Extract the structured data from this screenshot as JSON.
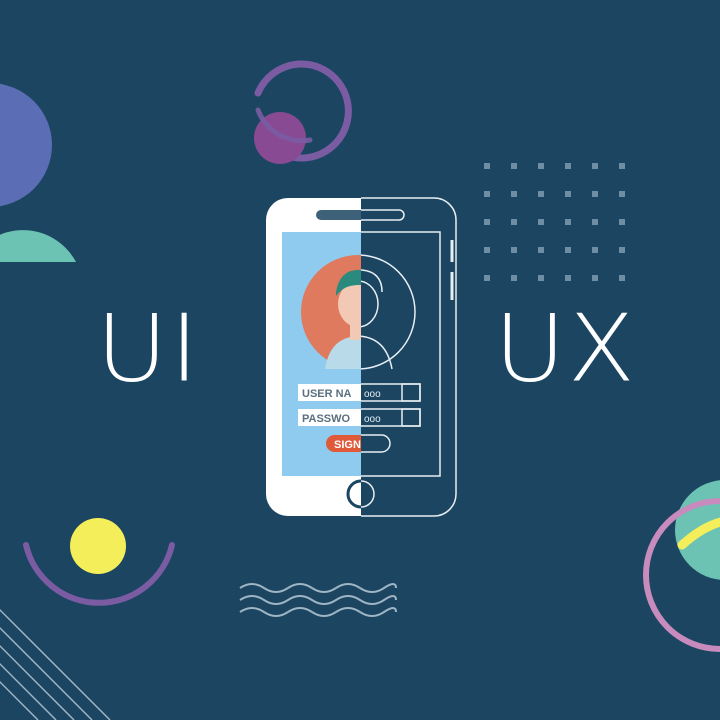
{
  "labels": {
    "left": "UI",
    "right": "UX"
  },
  "phone": {
    "username_label": "USER NA",
    "password_label": "PASSWO",
    "signin_label": "SIGN",
    "masked_dots": "ooo"
  },
  "colors": {
    "background": "#1b4560",
    "screen": "#8ecbee",
    "avatar_bg": "#e07a5f",
    "accent_orange": "#e05a3a",
    "purple": "#7b5ca3",
    "blue_circle": "#5a6db5",
    "teal": "#6cc3b4",
    "yellow": "#f3ee59",
    "pink": "#c78bbd",
    "grey_dots": "#6f8ea3"
  },
  "icons": [
    "avatar-icon",
    "home-button-icon",
    "dot-grid",
    "wave-lines"
  ]
}
